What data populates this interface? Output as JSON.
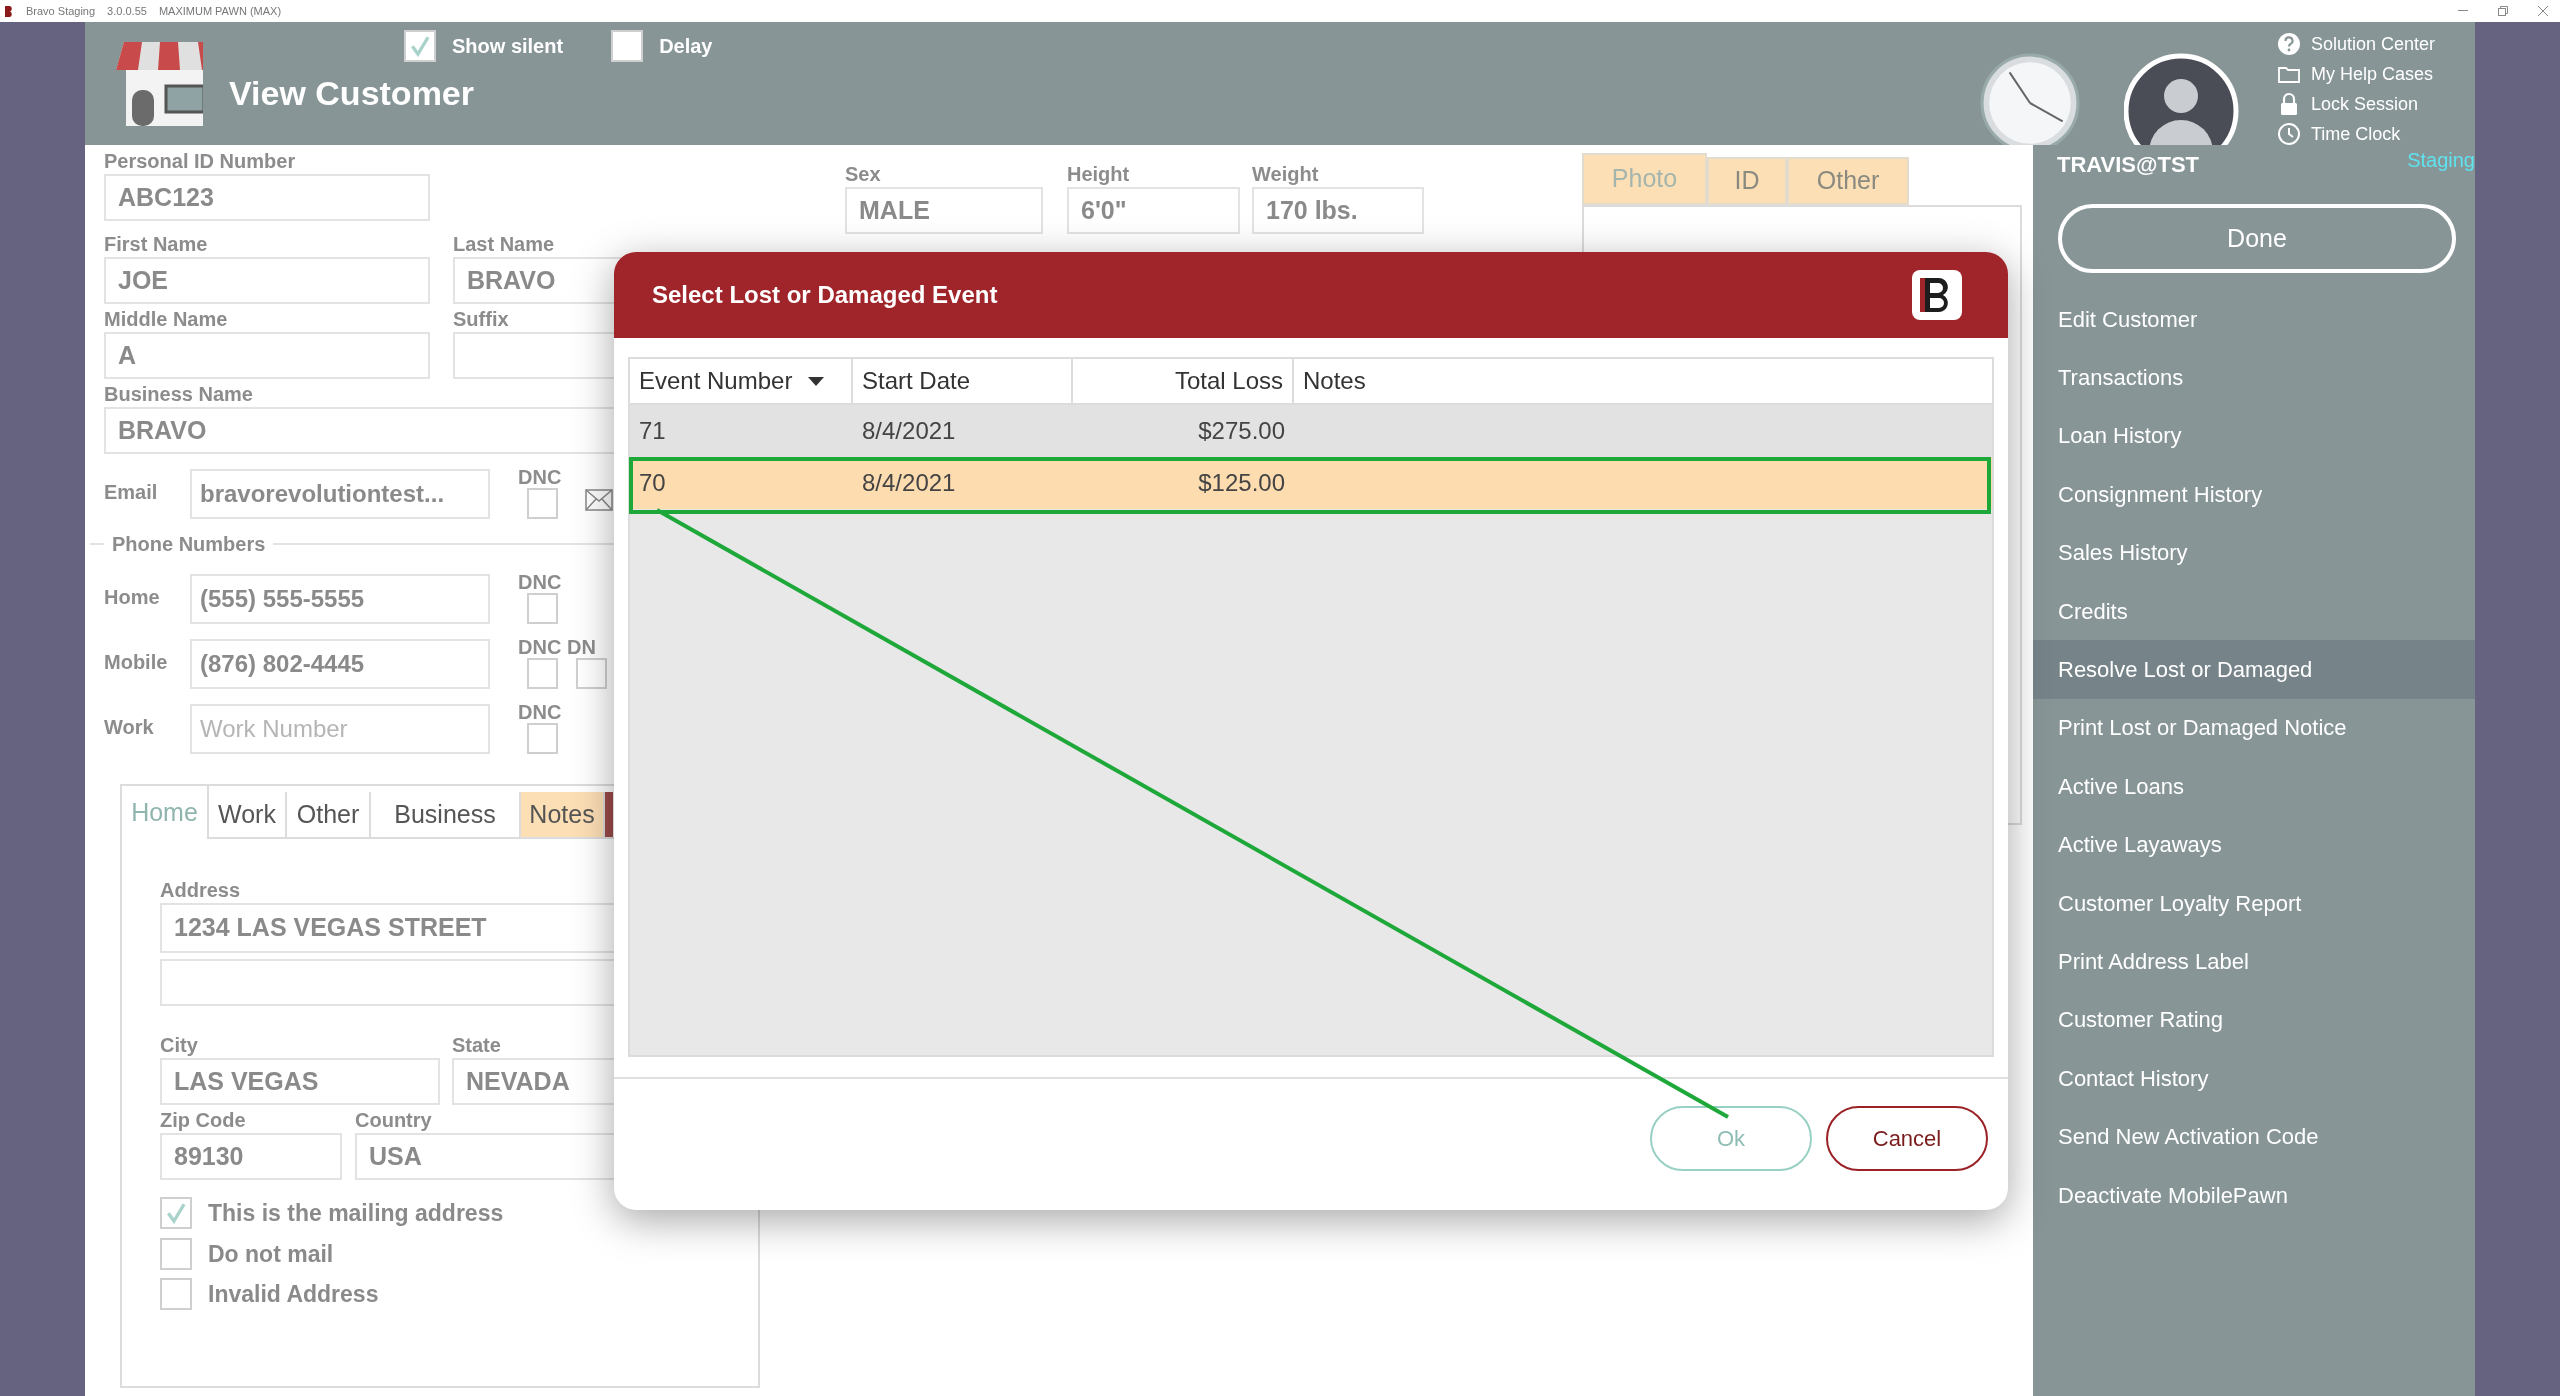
{
  "title_bar": {
    "app": "Bravo Staging",
    "version": "3.0.0.55",
    "store": "MAXIMUM PAWN (MAX)"
  },
  "header": {
    "title": "View Customer",
    "options": [
      {
        "label": "Show silent",
        "checked": true
      },
      {
        "label": "Delay",
        "checked": false
      }
    ],
    "links": [
      {
        "label": "Solution Center",
        "kind": "help"
      },
      {
        "label": "My Help Cases",
        "kind": "folder"
      },
      {
        "label": "Lock Session",
        "kind": "lock"
      },
      {
        "label": "Time Clock",
        "kind": "clock"
      }
    ],
    "environment": "Staging"
  },
  "customer": {
    "personal_id": {
      "label": "Personal ID Number",
      "value": "ABC123"
    },
    "first_name": {
      "label": "First Name",
      "value": "JOE"
    },
    "last_name": {
      "label": "Last Name",
      "value": "BRAVO"
    },
    "middle_name": {
      "label": "Middle Name",
      "value": "A"
    },
    "suffix": {
      "label": "Suffix"
    },
    "business_name": {
      "label": "Business Name",
      "value": "BRAVO"
    },
    "email": {
      "label": "Email",
      "value": "bravorevolutiontest...",
      "dnc_label": "DNC",
      "dnc": false
    },
    "phone_section": "Phone Numbers",
    "phones": [
      {
        "label": "Home",
        "value": "(555) 555-5555",
        "dnc_label": "DNC",
        "dnc": false
      },
      {
        "label": "Mobile",
        "value": "(876) 802-4445",
        "dnc_label": "DNC",
        "dnc": false,
        "extra_label": "DN",
        "extra_dnc": false
      },
      {
        "label": "Work",
        "placeholder": "Work Number",
        "dnc_label": "DNC",
        "dnc": false
      }
    ],
    "address_tabs": [
      {
        "label": "Home",
        "selected": true,
        "color": "#ffffff"
      },
      {
        "label": "Work",
        "selected": false,
        "color": "#ffffff"
      },
      {
        "label": "Other",
        "selected": false,
        "color": "#ffffff"
      },
      {
        "label": "Business",
        "selected": false,
        "color": "#ffffff"
      },
      {
        "label": "Notes",
        "selected": false,
        "color": "#fddfb5"
      }
    ],
    "address": {
      "label": "Address",
      "line1": "1234 LAS VEGAS STREET"
    },
    "city": {
      "label": "City",
      "value": "LAS VEGAS"
    },
    "state": {
      "label": "State",
      "value": "NEVADA"
    },
    "zip": {
      "label": "Zip Code",
      "value": "89130"
    },
    "country": {
      "label": "Country",
      "value": "USA"
    },
    "address_options": [
      {
        "label": "This is the mailing address",
        "checked": true
      },
      {
        "label": "Do not mail",
        "checked": false
      },
      {
        "label": "Invalid Address",
        "checked": false
      }
    ],
    "sex": {
      "label": "Sex",
      "value": "MALE"
    },
    "height": {
      "label": "Height",
      "value": "6'0\""
    },
    "weight": {
      "label": "Weight",
      "value": "170 lbs."
    },
    "media_tabs": [
      {
        "label": "Photo",
        "selected": true
      },
      {
        "label": "ID",
        "selected": false
      },
      {
        "label": "Other",
        "selected": false
      }
    ]
  },
  "sidebar": {
    "user": "TRAVIS@TST",
    "done": "Done",
    "items": [
      {
        "label": "Edit Customer",
        "selected": false
      },
      {
        "label": "Transactions",
        "selected": false
      },
      {
        "label": "Loan History",
        "selected": false
      },
      {
        "label": "Consignment History",
        "selected": false
      },
      {
        "label": "Sales History",
        "selected": false
      },
      {
        "label": "Credits",
        "selected": false
      },
      {
        "label": "Resolve Lost or Damaged",
        "selected": true
      },
      {
        "label": "Print Lost or Damaged Notice",
        "selected": false
      },
      {
        "label": "Active Loans",
        "selected": false
      },
      {
        "label": "Active Layaways",
        "selected": false
      },
      {
        "label": "Customer Loyalty Report",
        "selected": false
      },
      {
        "label": "Print Address Label",
        "selected": false
      },
      {
        "label": "Customer Rating",
        "selected": false
      },
      {
        "label": "Contact History",
        "selected": false
      },
      {
        "label": "Send New Activation Code",
        "selected": false
      },
      {
        "label": "Deactivate MobilePawn",
        "selected": false
      }
    ]
  },
  "dialog": {
    "title": "Select Lost or Damaged Event",
    "columns": [
      {
        "label": "Event Number",
        "sorted": true
      },
      {
        "label": "Start Date",
        "sorted": false
      },
      {
        "label": "Total Loss",
        "sorted": false
      },
      {
        "label": "Notes",
        "sorted": false
      }
    ],
    "rows": [
      {
        "cells": [
          "71",
          "8/4/2021",
          "$275.00"
        ],
        "selected": false
      },
      {
        "cells": [
          "70",
          "8/4/2021",
          "$125.00"
        ],
        "selected": true
      }
    ],
    "buttons": [
      {
        "label": "Ok",
        "kind": "ok"
      },
      {
        "label": "Cancel",
        "kind": "cancel"
      }
    ]
  }
}
